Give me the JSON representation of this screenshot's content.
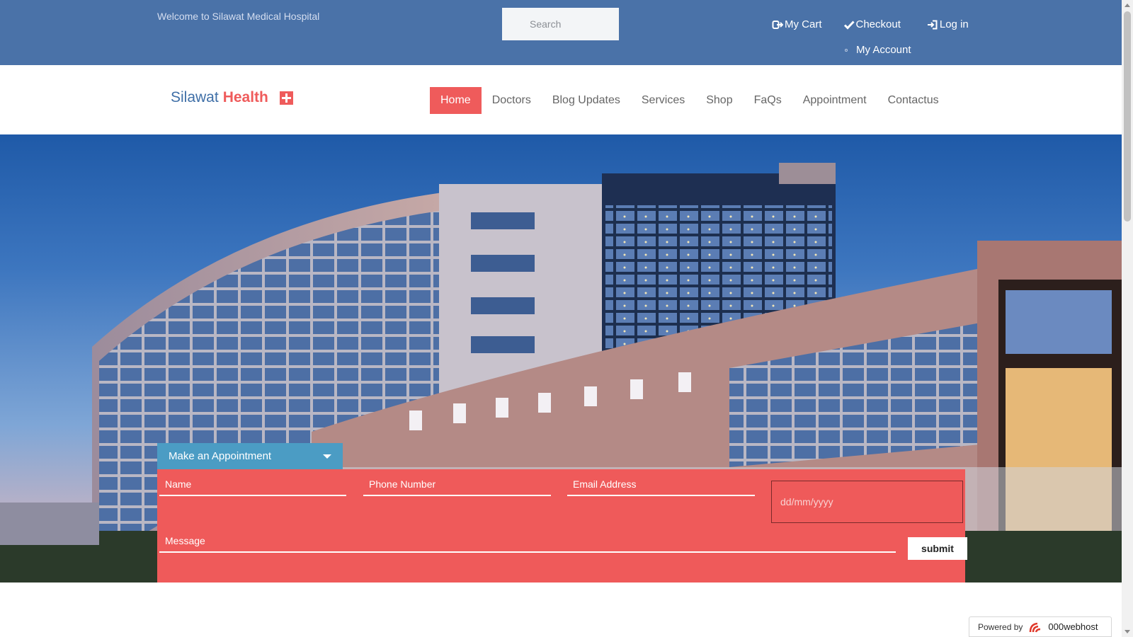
{
  "topbar": {
    "welcome": "Welcome to Silawat Medical Hospital",
    "search_placeholder": "Search",
    "links": {
      "cart": "My Cart",
      "checkout": "Checkout",
      "login": "Log in",
      "account": "My Account"
    },
    "icons": {
      "cart": "sign-out-icon",
      "checkout": "check-icon",
      "login": "sign-in-icon"
    }
  },
  "brand": {
    "part1": "Silawat",
    "part2": "Health",
    "icon": "medical-cross-icon"
  },
  "nav": {
    "items": [
      "Home",
      "Doctors",
      "Blog Updates",
      "Services",
      "Shop",
      "FaQs",
      "Appointment",
      "Contactus"
    ],
    "active": "Home"
  },
  "appointment": {
    "tab_label": "Make an Appointment",
    "name_placeholder": "Name",
    "phone_placeholder": "Phone Number",
    "email_placeholder": "Email Address",
    "date_placeholder": "dd/mm/yyyy",
    "message_placeholder": "Message",
    "submit_label": "submit"
  },
  "footer": {
    "powered_by": "Powered by",
    "host": "000webhost"
  },
  "colors": {
    "topbar": "#4a72a8",
    "accent": "#ef5b5b",
    "tab": "#4b9cc4",
    "brand_blue": "#3f6fa7"
  }
}
